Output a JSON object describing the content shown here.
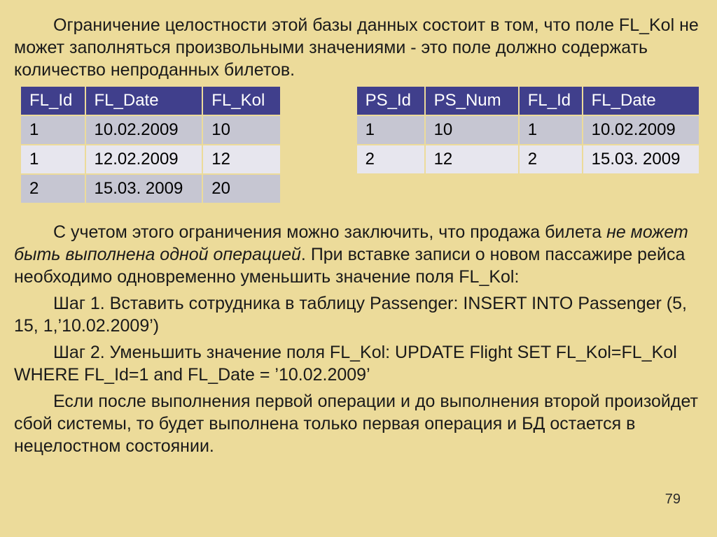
{
  "para1_a": "Ограничение целостности этой базы данных состоит в том, что ",
  "para1_b": "поле FL_Kol не может заполняться произвольными значениями - это поле должно содержать количество непроданных билетов.",
  "table1": {
    "headers": [
      "FL_Id",
      "FL_Date",
      "FL_Kol"
    ],
    "rows": [
      [
        "1",
        "10.02.2009",
        "10"
      ],
      [
        "1",
        "12.02.2009",
        "12"
      ],
      [
        "2",
        "15.03. 2009",
        "20"
      ]
    ]
  },
  "table2": {
    "headers": [
      "PS_Id",
      "PS_Num",
      "FL_Id",
      "FL_Date"
    ],
    "rows": [
      [
        "1",
        "10",
        "1",
        "10.02.2009"
      ],
      [
        "2",
        "12",
        "2",
        "15.03. 2009"
      ]
    ]
  },
  "para2_a": "С учетом этого ограничения можно заключить, что продажа билета ",
  "para2_em": "не может быть выполнена одной операцией",
  "para2_b": ". При вставке записи о новом пассажире рейса необходимо одновременно уменьшить значение поля FL_Kol:",
  "para3": "Шаг 1. Вставить сотрудника в таблицу Passenger: INSERT INTO Passenger (5, 15, 1,’10.02.2009’)",
  "para4": "Шаг 2. Уменьшить значение поля FL_Kol: UPDATE Flight SET FL_Kol=FL_Kol  WHERE  FL_Id=1 and FL_Date = ’10.02.2009’",
  "para5": "Если после выполнения первой операции и до выполнения второй произойдет сбой системы, то будет выполнена только первая операция и БД остается в нецелостном состоянии.",
  "pagenum": "79"
}
